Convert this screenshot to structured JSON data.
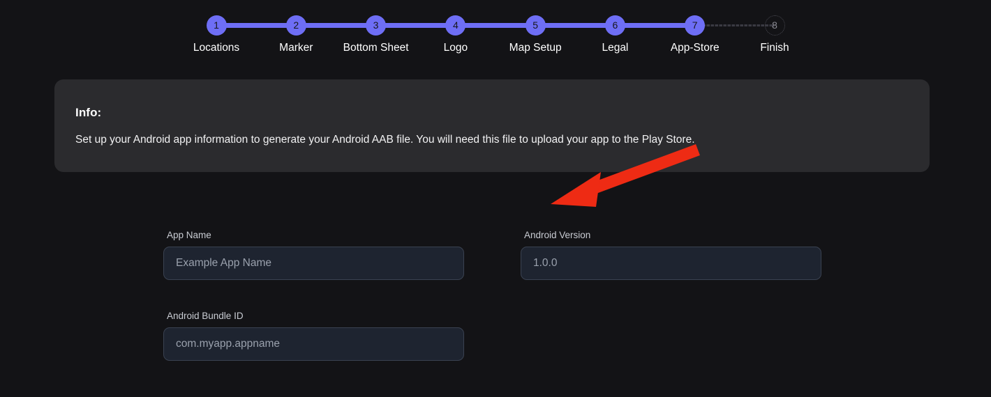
{
  "stepper": {
    "steps": [
      {
        "number": "1",
        "label": "Locations",
        "state": "active"
      },
      {
        "number": "2",
        "label": "Marker",
        "state": "active"
      },
      {
        "number": "3",
        "label": "Bottom Sheet",
        "state": "active"
      },
      {
        "number": "4",
        "label": "Logo",
        "state": "active"
      },
      {
        "number": "5",
        "label": "Map Setup",
        "state": "active"
      },
      {
        "number": "6",
        "label": "Legal",
        "state": "active"
      },
      {
        "number": "7",
        "label": "App-Store",
        "state": "active"
      },
      {
        "number": "8",
        "label": "Finish",
        "state": "inactive"
      }
    ],
    "active_color": "#6e6ef5",
    "inactive_color": "#8c8c95"
  },
  "info": {
    "title": "Info:",
    "text": "Set up your Android app information to generate your Android AAB file. You will need this file to upload your app to the Play Store."
  },
  "form": {
    "fields": {
      "app_name": {
        "label": "App Name",
        "value": "",
        "placeholder": "Example App Name"
      },
      "android_version": {
        "label": "Android Version",
        "value": "",
        "placeholder": "1.0.0"
      },
      "android_bundle_id": {
        "label": "Android Bundle ID",
        "value": "",
        "placeholder": "com.myapp.appname"
      }
    }
  },
  "annotation": {
    "arrow_color": "#ee2b14"
  }
}
